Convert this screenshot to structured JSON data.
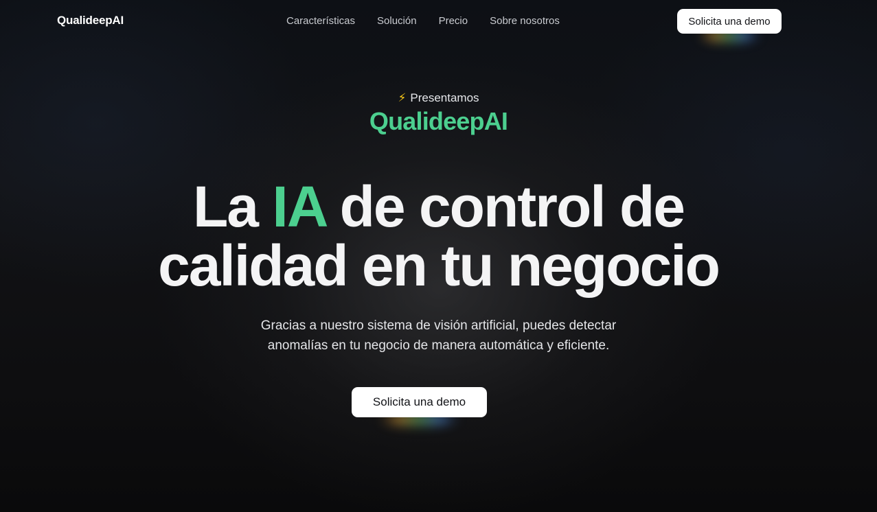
{
  "nav": {
    "brand": "QualideepAI",
    "links": [
      "Características",
      "Solución",
      "Precio",
      "Sobre nosotros"
    ],
    "cta_label": "Solicita una demo"
  },
  "hero": {
    "eyebrow_icon": "lightning-bolt-icon",
    "eyebrow_text": "Presentamos",
    "product_name": "QualideepAI",
    "headline_part1": "La ",
    "headline_accent": "IA",
    "headline_part2": " de control de",
    "headline_line2": "calidad en tu negocio",
    "subtitle": "Gracias a nuestro sistema de visión artificial, puedes detectar anomalías en tu negocio de manera automática y eficiente.",
    "cta_label": "Solicita una demo"
  },
  "colors": {
    "accent": "#4ccf8f",
    "background": "#0e0e10",
    "button_bg": "#ffffff",
    "bolt": "#f5c518"
  }
}
